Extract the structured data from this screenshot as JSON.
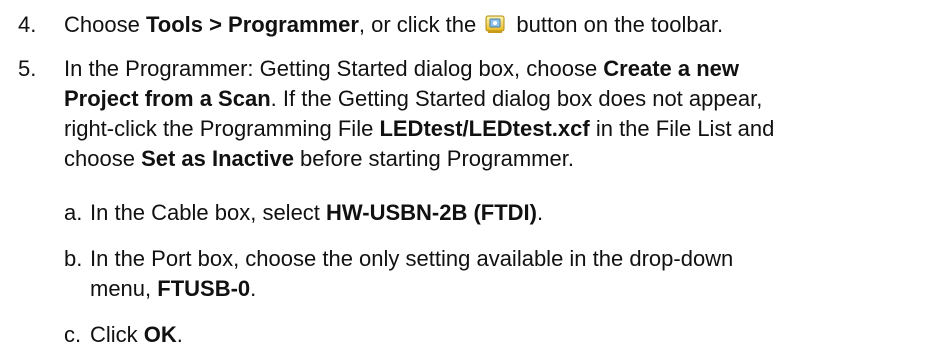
{
  "step4": {
    "number": "4.",
    "t1": "Choose ",
    "b1": "Tools > Programmer",
    "t2": ", or click the",
    "t3": " button on the toolbar.",
    "icon": "programmer-toolbar-icon"
  },
  "step5": {
    "number": "5.",
    "l1_t1": "In the Programmer: Getting Started dialog box, choose ",
    "l1_b1": "Create a new",
    "l2_b1": "Project from a Scan",
    "l2_t1": ". If the Getting Started dialog box does not appear,",
    "l3_t1": "right-click the Programming File ",
    "l3_b1": "LEDtest/LEDtest.xcf",
    "l3_t2": " in the File List and",
    "l4_t1": "choose ",
    "l4_b1": "Set as Inactive",
    "l4_t2": " before starting Programmer."
  },
  "sub_a": {
    "letter": "a.",
    "t1": "In the Cable box, select ",
    "b1": "HW-USBN-2B (FTDI)",
    "t2": "."
  },
  "sub_b": {
    "letter": "b.",
    "l1_t1": "In the Port box, choose the only setting available in the drop-down",
    "l2_t1": "menu, ",
    "l2_b1": "FTUSB-0",
    "l2_t2": "."
  },
  "sub_c": {
    "letter": "c.",
    "t1": "Click ",
    "b1": "OK",
    "t2": "."
  }
}
